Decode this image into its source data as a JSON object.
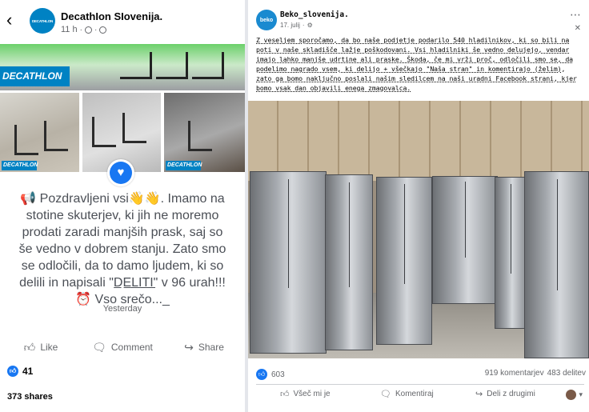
{
  "left_post": {
    "author": "DecathIon SIovenija.",
    "time": "11 h",
    "logo_text": "DECATHLON",
    "body": "📢 Pozdravljeni vsi👋👋. Imamo na stotine skuterjev, ki jih ne moremo prodati zaradi manjših prask, saj so še vedno v dobrem stanju. Zato smo se odločili, da to damo ljudem, ki so delili in napisali \"D̲E̲L̲I̲T̲I̲\" v 96 urah!!!⏰ Vso srečo..._",
    "comment_time": "Yesterday",
    "actions": {
      "like": "Like",
      "comment": "Comment",
      "share": "Share"
    },
    "reaction_count": "41",
    "shares": "373 shares"
  },
  "right_post": {
    "author": "Beko_slovenija.",
    "date": "17. julij",
    "avatar_text": "beko",
    "body": "Z veseljem sporočamo, da bo naše podjetje podarilo 540 hladilnikov, ki so bili na poti v naše skladišče lažje poškodovani. Vsi hladilniki še vedno delujejo, vendar imajo lahko manjše udrtine ali praske. Škoda, če mi vrži proč, odločili smo se, da podelimo nagrado vsem, ki delijo + všečkajo \"Naša stran\" in komentirajo (želim), zato ga bomo naključno poslali našim sledilcem na naši uradni Facebook strani, kjer bomo vsak dan objavili enega zmagovalca.",
    "reaction_count": "603",
    "comments": "919 komentarjev",
    "shares": "483 delitev",
    "actions": {
      "like": "Všeč mi je",
      "comment": "Komentiraj",
      "share": "Deli z drugimi"
    }
  },
  "icons": {
    "back": "back-arrow-icon",
    "globe": "globe-icon",
    "like": "thumbs-up-icon",
    "comment": "comment-icon",
    "share": "share-icon",
    "heart": "heart-icon",
    "more": "more-icon",
    "close": "close-icon"
  },
  "colors": {
    "facebook_blue": "#1877f2",
    "decathlon_blue": "#0082c3",
    "beko_blue": "#1a8ad0"
  }
}
